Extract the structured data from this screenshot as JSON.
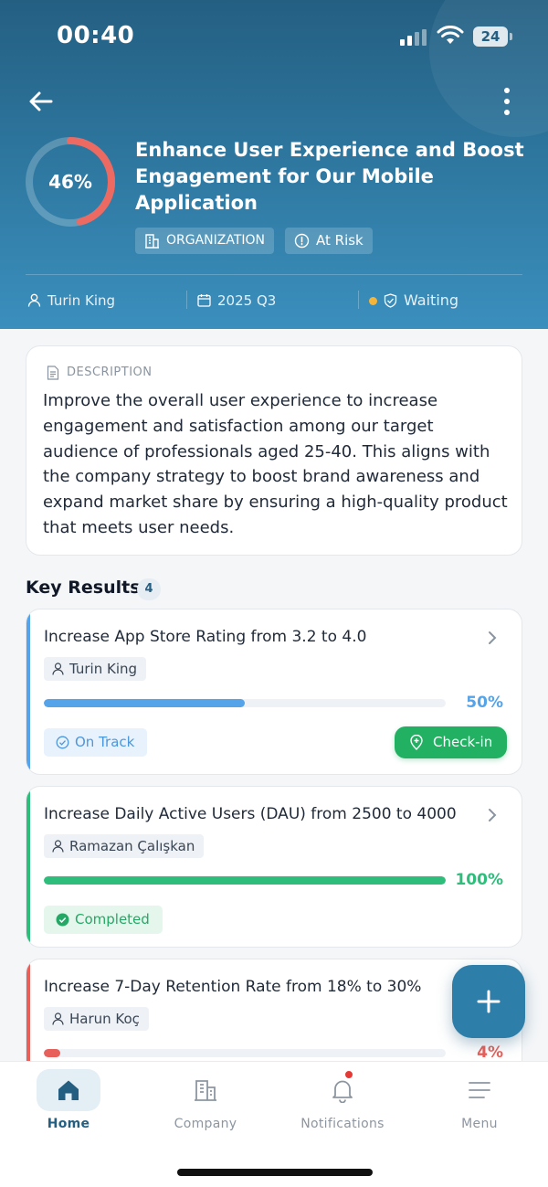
{
  "status_bar": {
    "time": "00:40",
    "battery": "24"
  },
  "objective": {
    "progress_label": "46%",
    "progress": 0.46,
    "title": "Enhance User Experience and Boost Engagement for Our Mobile Application",
    "tags": {
      "level": "ORGANIZATION",
      "risk": "At Risk"
    },
    "owner": "Turin King",
    "period": "2025 Q3",
    "status": "Waiting"
  },
  "description": {
    "label": "DESCRIPTION",
    "text": "Improve the overall user experience to increase engagement and satisfaction among our target audience of professionals aged 25-40. This aligns with the company strategy to boost brand awareness and expand market share by ensuring a high-quality product that meets user needs."
  },
  "key_results": {
    "heading": "Key Results",
    "count": "4",
    "items": [
      {
        "title": "Increase App Store Rating from 3.2 to 4.0",
        "owner": "Turin King",
        "progress": 0.5,
        "percent": "50%",
        "status": "On Track",
        "checkin": "Check-in",
        "color": "#55a3e8"
      },
      {
        "title": "Increase Daily Active Users (DAU) from 2500 to 4000",
        "owner": "Ramazan Çalışkan",
        "progress": 1.0,
        "percent": "100%",
        "status": "Completed",
        "color": "#2ebd7a"
      },
      {
        "title": "Increase 7-Day Retention Rate from 18% to 30%",
        "owner": "Harun Koç",
        "progress": 0.04,
        "percent": "4%",
        "color": "#e8605a"
      }
    ]
  },
  "nav": {
    "items": [
      {
        "label": "Home"
      },
      {
        "label": "Company"
      },
      {
        "label": "Notifications"
      },
      {
        "label": "Menu"
      }
    ]
  },
  "colors": {
    "header": "#2f7aa3",
    "accent": "#245f82",
    "risk": "#e8605a",
    "success": "#22b062",
    "warning": "#f5b43a"
  }
}
